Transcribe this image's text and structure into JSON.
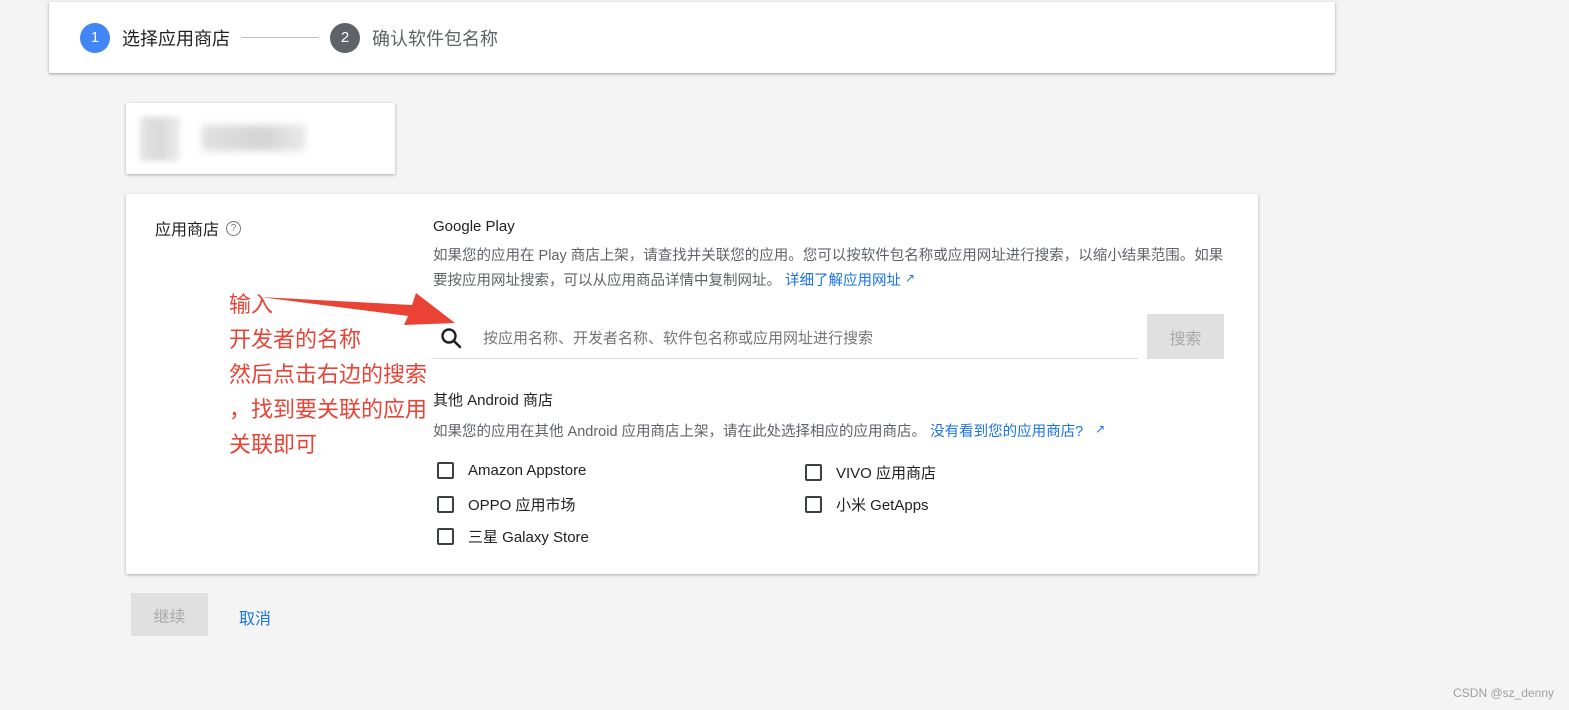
{
  "stepper": {
    "steps": [
      {
        "number": "1",
        "label": "选择应用商店",
        "state": "active"
      },
      {
        "number": "2",
        "label": "确认软件包名称",
        "state": "inactive"
      }
    ]
  },
  "form": {
    "field_label": "应用商店",
    "help_icon": "?",
    "google_play": {
      "title": "Google Play",
      "description": "如果您的应用在 Play 商店上架，请查找并关联您的应用。您可以按软件包名称或应用网址进行搜索，以缩小结果范围。如果要按应用网址搜索，可以从应用商品详情中复制网址。",
      "link": "详细了解应用网址",
      "search_placeholder": "按应用名称、开发者名称、软件包名称或应用网址进行搜索",
      "search_button": "搜索"
    },
    "other_stores": {
      "title": "其他 Android 商店",
      "description": "如果您的应用在其他 Android 应用商店上架，请在此处选择相应的应用商店。",
      "link": "没有看到您的应用商店?",
      "stores": [
        "Amazon Appstore",
        "VIVO 应用商店",
        "OPPO 应用市场",
        "小米 GetApps",
        "三星 Galaxy Store"
      ]
    }
  },
  "annotation": {
    "lines": [
      "输入",
      "开发者的名称",
      "然后点击右边的搜索",
      "，找到要关联的应用",
      "关联即可"
    ],
    "color": "#ea4335"
  },
  "actions": {
    "continue": "继续",
    "cancel": "取消"
  },
  "watermark": "CSDN @sz_denny",
  "colors": {
    "accent": "#1a73e8",
    "step_active": "#4285f4",
    "annotation": "#ea4335"
  }
}
